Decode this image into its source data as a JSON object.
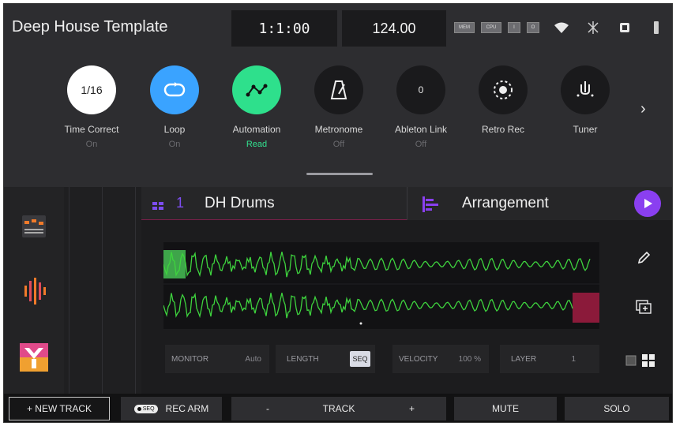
{
  "header": {
    "project_title": "Deep House Template",
    "position": "1:1:00",
    "tempo": "124.00",
    "meters": [
      "MEM",
      "CPU",
      "I",
      "O"
    ]
  },
  "toolbar": [
    {
      "label": "Time Correct",
      "value": "On",
      "icon_text": "1/16",
      "icon": "time-correct-icon",
      "color": "#ffffff"
    },
    {
      "label": "Loop",
      "value": "On",
      "icon_text": "",
      "icon": "loop-icon",
      "color": "#3aa3ff"
    },
    {
      "label": "Automation",
      "value": "Read",
      "icon_text": "",
      "icon": "automation-icon",
      "color": "#2ee08c"
    },
    {
      "label": "Metronome",
      "value": "Off",
      "icon_text": "",
      "icon": "metronome-icon",
      "color": "#1a1a1c"
    },
    {
      "label": "Ableton Link",
      "value": "Off",
      "icon_text": "0",
      "icon": "ableton-link-icon",
      "color": "#1a1a1c"
    },
    {
      "label": "Retro Rec",
      "value": "",
      "icon_text": "",
      "icon": "retro-rec-icon",
      "color": "#1a1a1c"
    },
    {
      "label": "Tuner",
      "value": "",
      "icon_text": "",
      "icon": "tuner-icon",
      "color": "#1a1a1c"
    }
  ],
  "track": {
    "number": "1",
    "name": "DH Drums"
  },
  "arrangement": {
    "label": "Arrangement"
  },
  "params": {
    "monitor_label": "MONITOR",
    "monitor_value": "Auto",
    "length_label": "LENGTH",
    "length_value": "SEQ",
    "velocity_label": "VELOCITY",
    "velocity_value": "100 %",
    "layer_label": "LAYER",
    "layer_value": "1"
  },
  "bottom": {
    "new_track": "+ NEW TRACK",
    "seq_badge": "SEQ",
    "rec_arm": "REC ARM",
    "minus": "-",
    "track": "TRACK",
    "plus": "+",
    "mute": "MUTE",
    "solo": "SOLO"
  },
  "colors": {
    "accent_purple": "#8a3ff0",
    "waveform_green": "#3ed43e",
    "clip_red": "#8b1a3a"
  }
}
